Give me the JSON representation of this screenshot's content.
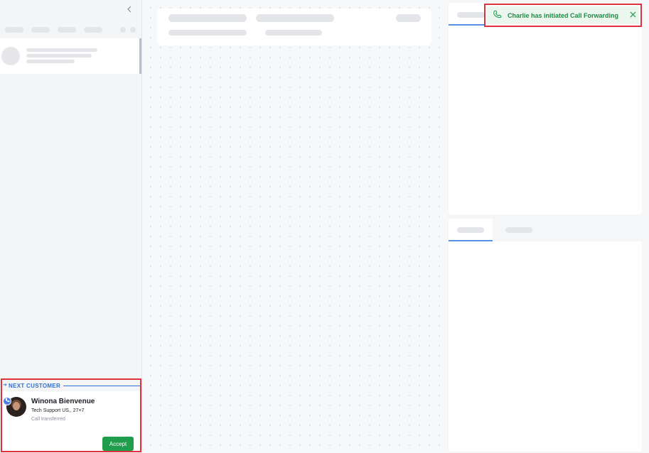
{
  "toast": {
    "message": "Charlie has initiated Call Forwarding",
    "icon": "phone-icon",
    "close_icon": "close-icon",
    "color": "#1f9d4d"
  },
  "sidebar": {
    "collapse_icon": "chevron-left-icon",
    "next_customer": {
      "section_title": "NEXT CUSTOMER",
      "name": "Winona Bienvenue",
      "queue": "Tech Support US,, 27×7",
      "status": "Call transferred",
      "accept_label": "Accept",
      "accent_color": "#2f6fd6",
      "accept_color": "#1f9d4d"
    }
  }
}
